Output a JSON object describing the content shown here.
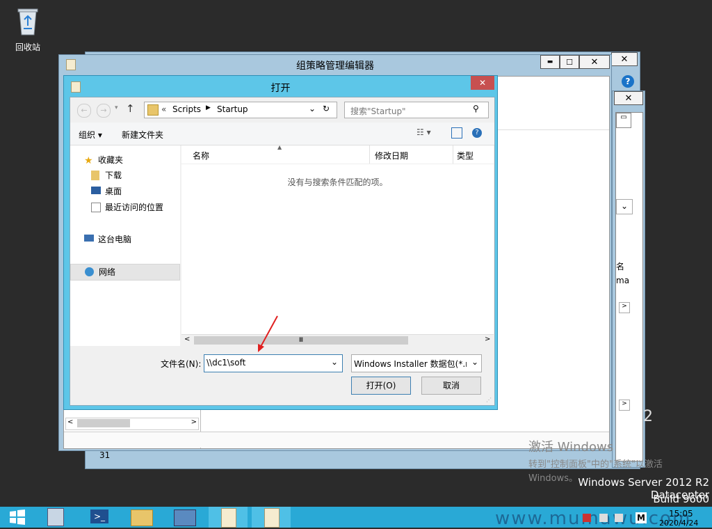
{
  "desktop": {
    "recycle_bin_label": "回收站",
    "watermark_activate_title": "激活 Windows",
    "watermark_activate_sub": "转到\"控制面板\"中的\"系统\"以激活",
    "watermark_activate_sub2": "Windows。",
    "os_name": "Windows Server 2012 R2 Datacenter",
    "os_build": "Build 9600",
    "site_watermark": "www.mumawu.com",
    "bg_digit": "2"
  },
  "gpo_editor": {
    "title": "组策略管理编辑器",
    "minimize_label": "▬",
    "maximize_label": "☐",
    "close_label": "✕"
  },
  "back_window": {
    "close_label": "✕",
    "help_label": "?",
    "partial_col1": "名",
    "partial_col2": "ma",
    "number": "31"
  },
  "open_dialog": {
    "title": "打开",
    "close_label": "✕",
    "breadcrumb": [
      "Scripts",
      "Startup"
    ],
    "breadcrumb_prefix": "«",
    "search_placeholder": "搜索\"Startup\"",
    "toolbar": {
      "organize_label": "组织",
      "new_folder_label": "新建文件夹"
    },
    "nav": {
      "favorites": "收藏夹",
      "downloads": "下载",
      "desktop": "桌面",
      "recent": "最近访问的位置",
      "this_pc": "这台电脑",
      "network": "网络"
    },
    "columns": [
      "名称",
      "修改日期",
      "类型"
    ],
    "empty_message": "没有与搜索条件匹配的项。",
    "filename_label": "文件名(N):",
    "filename_value": "\\\\dc1\\soft",
    "filetype_value": "Windows Installer 数据包(*.m",
    "open_button": "打开(O)",
    "cancel_button": "取消",
    "scroll_thumb": "Ⅲ"
  },
  "taskbar": {
    "time": "15:05",
    "date": "2020/4/24"
  },
  "colors": {
    "dialog_title_bg": "#5dc6e8",
    "taskbar": "#29a9d6",
    "close_red": "#c75050"
  }
}
